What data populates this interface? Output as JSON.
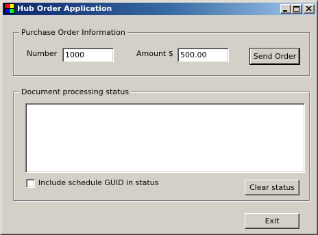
{
  "window": {
    "title": "Hub Order Application",
    "icon": "app-icon",
    "controls": [
      "minimize-icon",
      "maximize-icon",
      "close-icon"
    ]
  },
  "purchase_order": {
    "group_label": "Purchase Order Information",
    "number_label": "Number",
    "number_value": "1000",
    "amount_label": "Amount  $",
    "amount_value": "500.00",
    "send_button": "Send Order"
  },
  "status": {
    "group_label": "Document processing status",
    "text": "",
    "checkbox_label": "Include schedule GUID in status",
    "checkbox_checked": false,
    "clear_button": "Clear status"
  },
  "footer": {
    "exit_button": "Exit"
  },
  "colors": {
    "face": "#d4d0c8",
    "title_start": "#0a246a",
    "title_end": "#a6caf0",
    "title_text": "#ffffff"
  }
}
